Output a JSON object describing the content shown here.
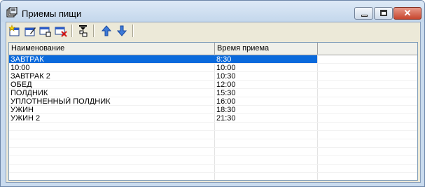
{
  "window": {
    "title": "Приемы пищи",
    "close_glyph": "✕"
  },
  "toolbar": {
    "icons": [
      "add-record-icon",
      "edit-record-icon",
      "copy-record-icon",
      "delete-record-icon",
      "filter-icon",
      "move-up-icon",
      "move-down-icon"
    ]
  },
  "grid": {
    "columns": [
      "Наименование",
      "Время приема"
    ],
    "rows": [
      {
        "name": "ЗАВТРАК",
        "time": "8:30",
        "selected": true
      },
      {
        "name": "10:00",
        "time": "10:00"
      },
      {
        "name": "ЗАВТРАК 2",
        "time": "10:30"
      },
      {
        "name": "ОБЕД",
        "time": "12:00"
      },
      {
        "name": "ПОЛДНИК",
        "time": "15:30"
      },
      {
        "name": "УПЛОТНЕННЫЙ ПОЛДНИК",
        "time": "16:00"
      },
      {
        "name": "УЖИН",
        "time": "18:30"
      },
      {
        "name": "УЖИН 2",
        "time": "21:30"
      }
    ]
  },
  "colors": {
    "selection": "#0a6adc",
    "frame": "#c9dbee"
  }
}
